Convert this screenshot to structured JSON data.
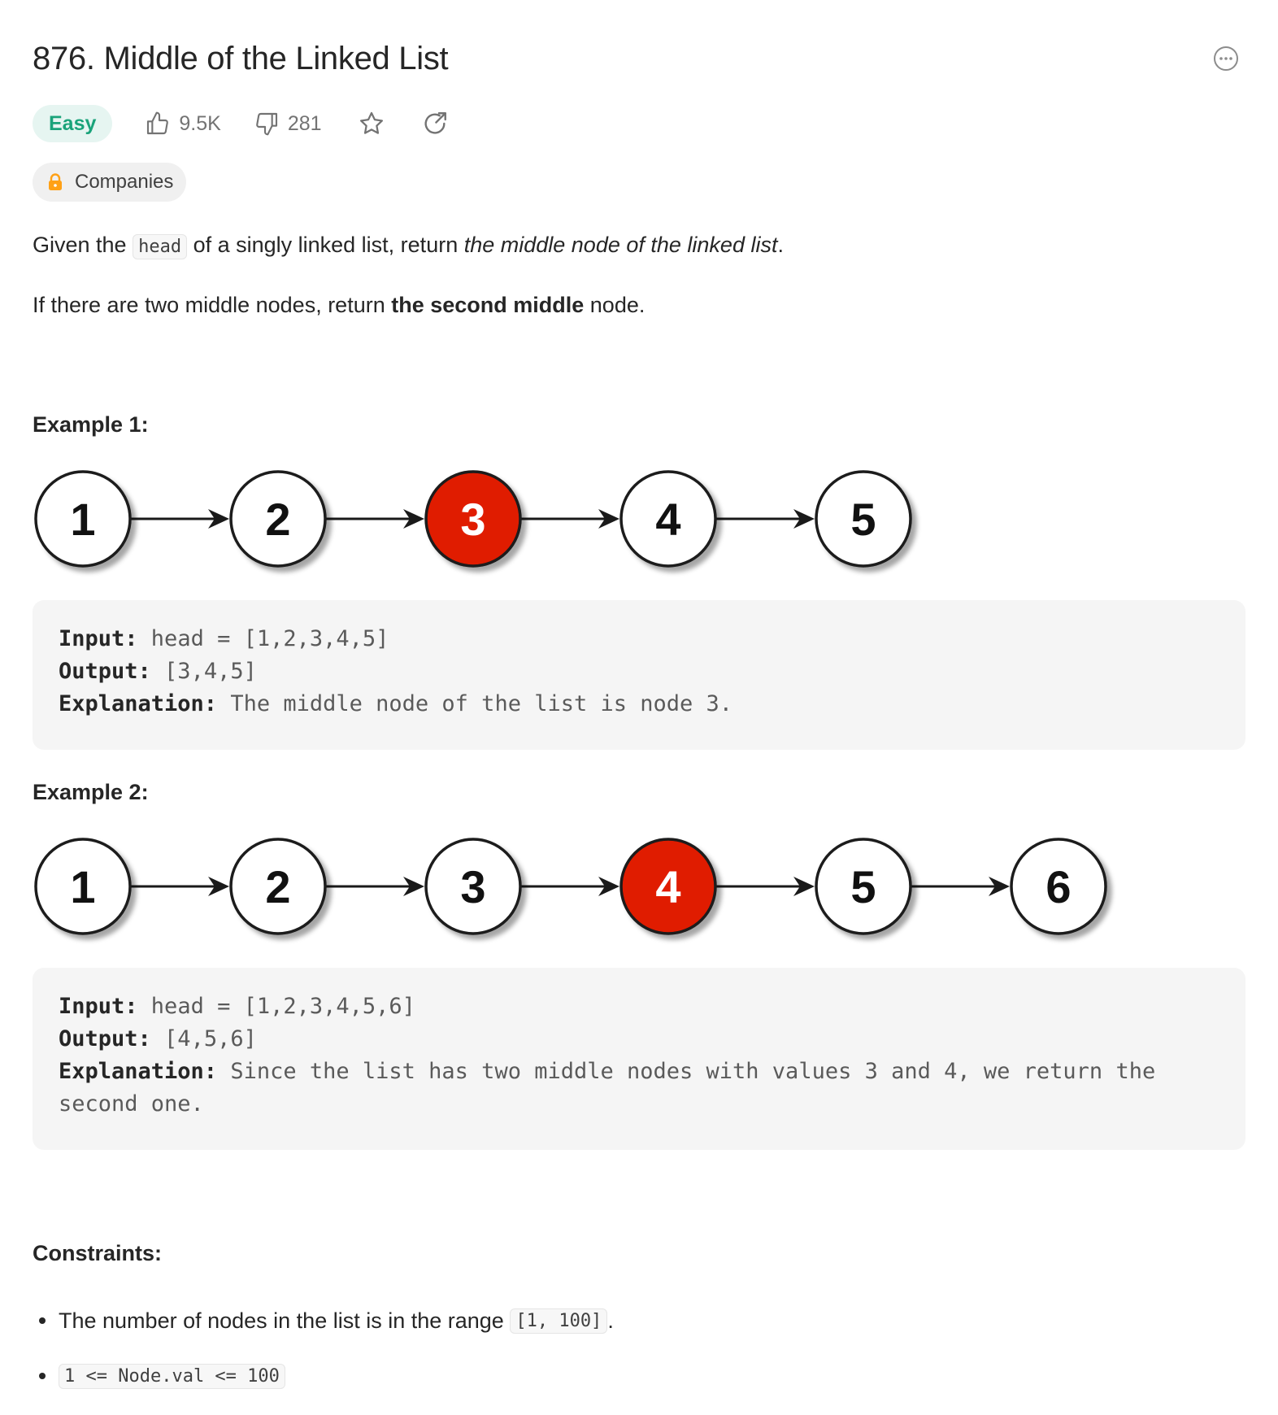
{
  "problem": {
    "title": "876. Middle of the Linked List",
    "difficulty": "Easy",
    "likes": "9.5K",
    "dislikes": "281",
    "companies_label": "Companies"
  },
  "description": {
    "p1_before": "Given the ",
    "p1_code": "head",
    "p1_mid": " of a singly linked list, return ",
    "p1_em": "the middle node of the linked list",
    "p1_end": ".",
    "p2_before": "If there are two middle nodes, return ",
    "p2_strong": "the second middle",
    "p2_end": " node."
  },
  "examples": [
    {
      "heading": "Example 1:",
      "nodes": [
        "1",
        "2",
        "3",
        "4",
        "5"
      ],
      "highlight_index": 2,
      "input_label": "Input:",
      "input": " head = [1,2,3,4,5]",
      "output_label": "Output:",
      "output": " [3,4,5]",
      "explanation_label": "Explanation:",
      "explanation": " The middle node of the list is node 3."
    },
    {
      "heading": "Example 2:",
      "nodes": [
        "1",
        "2",
        "3",
        "4",
        "5",
        "6"
      ],
      "highlight_index": 3,
      "input_label": "Input:",
      "input": " head = [1,2,3,4,5,6]",
      "output_label": "Output:",
      "output": " [4,5,6]",
      "explanation_label": "Explanation:",
      "explanation": " Since the list has two middle nodes with values 3 and 4, we return the second one."
    }
  ],
  "constraints": {
    "heading": "Constraints:",
    "c1_text": "The number of nodes in the list is in the range ",
    "c1_code": "[1, 100]",
    "c1_end": ".",
    "c2_code": "1 <= Node.val <= 100"
  },
  "colors": {
    "easy_text": "#1aa37a",
    "easy_bg": "#e6f5f1",
    "node_highlight": "#e01b00",
    "lock": "#ffa116"
  },
  "icons": [
    "more-icon",
    "thumbs-up-icon",
    "thumbs-down-icon",
    "star-icon",
    "share-icon",
    "lock-icon"
  ]
}
